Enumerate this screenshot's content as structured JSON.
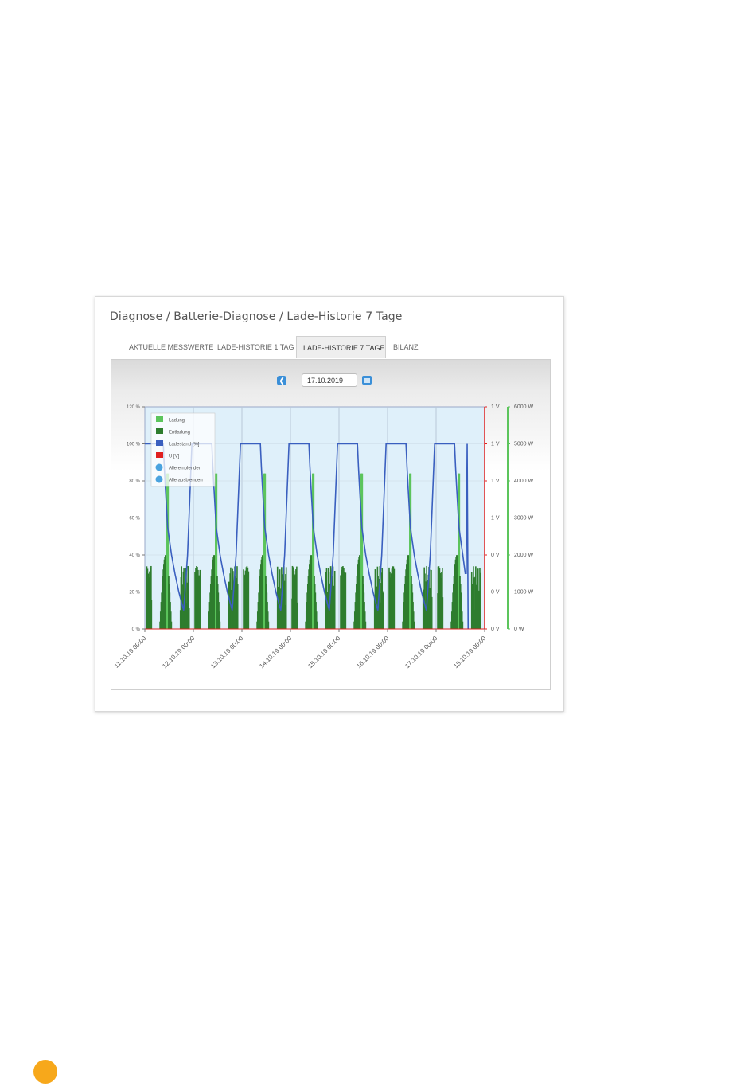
{
  "breadcrumb": "Diagnose / Batterie-Diagnose / Lade-Historie 7 Tage",
  "tabs": [
    {
      "label": "AKTUELLE MESSWERTE",
      "active": false
    },
    {
      "label": "LADE-HISTORIE 1 TAG",
      "active": false
    },
    {
      "label": "LADE-HISTORIE 7 TAGE",
      "active": true
    },
    {
      "label": "BILANZ",
      "active": false
    }
  ],
  "date_value": "17.10.2019",
  "icons": {
    "prev": "chevron-left-icon",
    "calendar": "calendar-icon"
  },
  "colors": {
    "ladung": "#5cc55c",
    "entladung": "#2e7d2e",
    "ladestand": "#3a5fbf",
    "voltage": "#e02020",
    "plot_bg": "#dff0fa",
    "accent": "#f7a81b"
  },
  "chart_data": {
    "type": "area",
    "categories": [
      "11.10.19 00:00",
      "12.10.19 00:00",
      "13.10.19 00:00",
      "14.10.19 00:00",
      "15.10.19 00:00",
      "16.10.19 00:00",
      "17.10.19 00:00",
      "18.10.19 00:00"
    ],
    "y_left": {
      "ticks": [
        "120 %",
        "100 %",
        "80 %",
        "60 %",
        "40 %",
        "20 %",
        "0 %"
      ],
      "range": [
        0,
        120
      ]
    },
    "y_right_voltage": {
      "ticks": [
        "1 V",
        "1 V",
        "1 V",
        "1 V",
        "0 V",
        "0 V",
        "0 V"
      ]
    },
    "y_right_power": {
      "ticks": [
        "6000 W",
        "5000 W",
        "4000 W",
        "3000 W",
        "2000 W",
        "1000 W",
        "0 W"
      ],
      "range": [
        0,
        6000
      ]
    },
    "legend": [
      "Ladung",
      "Entladung",
      "Ladestand [%]",
      "U [V]",
      "Alle einblenden",
      "Alle ausblenden"
    ],
    "legend_position": "top-left",
    "grid": true,
    "series": [
      {
        "name": "Ladestand [%]",
        "x_days": [
          0,
          0.02,
          0.1,
          0.18,
          0.25,
          0.32,
          0.38,
          0.4,
          0.42,
          0.47,
          0.55,
          0.62,
          0.7,
          0.75,
          0.8,
          0.88,
          0.94,
          0.97,
          1.0,
          1.02,
          1.1,
          1.18,
          1.25,
          1.32,
          1.38,
          1.4,
          1.42,
          1.47,
          1.55,
          1.62,
          1.7,
          1.75,
          1.8,
          1.88,
          1.94,
          1.97,
          2.0,
          2.02,
          2.1,
          2.18,
          2.25,
          2.32,
          2.38,
          2.4,
          2.42,
          2.47,
          2.55,
          2.62,
          2.7,
          2.75,
          2.8,
          2.88,
          2.94,
          2.97,
          3.0,
          3.02,
          3.1,
          3.18,
          3.25,
          3.32,
          3.38,
          3.4,
          3.42,
          3.47,
          3.55,
          3.62,
          3.7,
          3.75,
          3.8,
          3.88,
          3.94,
          3.97,
          4.0,
          4.02,
          4.1,
          4.18,
          4.25,
          4.32,
          4.38,
          4.4,
          4.42,
          4.47,
          4.55,
          4.62,
          4.7,
          4.75,
          4.8,
          4.88,
          4.94,
          4.97,
          5.0,
          5.02,
          5.1,
          5.18,
          5.25,
          5.32,
          5.38,
          5.4,
          5.42,
          5.47,
          5.55,
          5.62,
          5.7,
          5.75,
          5.8,
          5.88,
          5.94,
          5.97,
          6.0,
          6.02,
          6.1,
          6.18,
          6.25,
          6.32,
          6.38,
          6.4,
          6.42,
          6.47,
          6.55,
          6.6,
          6.62,
          6.64,
          6.66
        ],
        "values": [
          100,
          100,
          100,
          100,
          100,
          100,
          100,
          88,
          78,
          55,
          40,
          30,
          20,
          15,
          10,
          40,
          80,
          100,
          100,
          100,
          100,
          100,
          100,
          100,
          100,
          88,
          78,
          55,
          40,
          30,
          20,
          15,
          10,
          40,
          80,
          100,
          100,
          100,
          100,
          100,
          100,
          100,
          100,
          88,
          78,
          55,
          40,
          30,
          20,
          15,
          10,
          40,
          80,
          100,
          100,
          100,
          100,
          100,
          100,
          100,
          100,
          88,
          78,
          55,
          40,
          30,
          20,
          15,
          10,
          40,
          80,
          100,
          100,
          100,
          100,
          100,
          100,
          100,
          100,
          88,
          78,
          55,
          40,
          30,
          20,
          15,
          10,
          40,
          80,
          100,
          100,
          100,
          100,
          100,
          100,
          100,
          100,
          88,
          78,
          55,
          40,
          30,
          20,
          15,
          10,
          40,
          80,
          100,
          100,
          100,
          100,
          100,
          100,
          100,
          100,
          88,
          78,
          55,
          40,
          30,
          30,
          100,
          0
        ]
      },
      {
        "name": "Ladung",
        "unit": "W",
        "peaks_per_day": [
          4000,
          4000,
          4000,
          4000,
          4000,
          4000,
          4000
        ]
      },
      {
        "name": "Entladung",
        "unit": "W",
        "peaks_per_day": [
          1700,
          1700,
          1700,
          1700,
          1700,
          1700,
          1700
        ]
      },
      {
        "name": "U [V]",
        "values": [
          0
        ]
      }
    ]
  }
}
